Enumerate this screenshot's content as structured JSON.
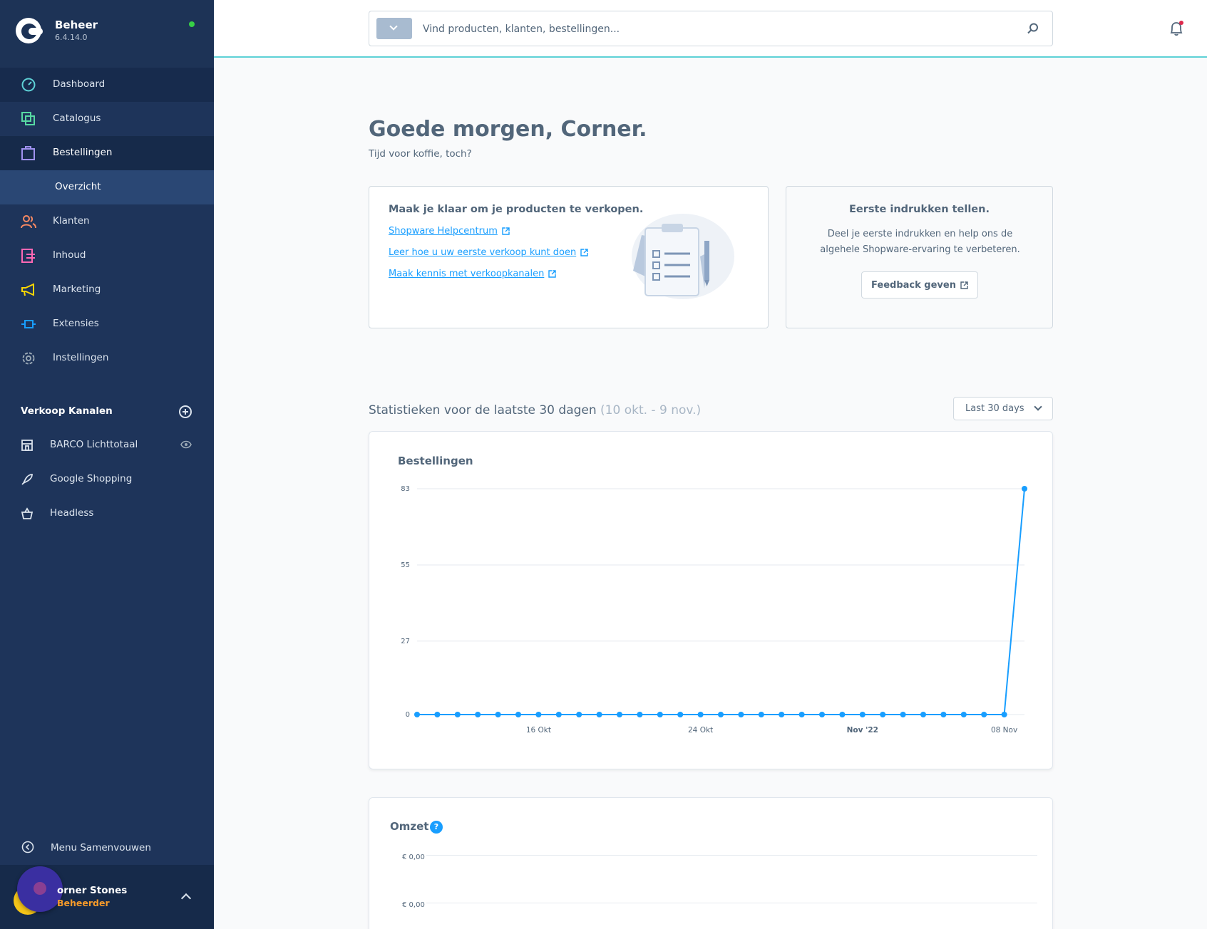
{
  "brand": {
    "title": "Beheer",
    "version": "6.4.14.0",
    "status_color": "#37d046"
  },
  "nav": {
    "items": [
      {
        "label": "Dashboard",
        "icon": "dashboard-icon",
        "color": "#5ed1d6"
      },
      {
        "label": "Catalogus",
        "icon": "catalog-icon",
        "color": "#57d9a3"
      },
      {
        "label": "Bestellingen",
        "icon": "orders-icon",
        "color": "#a092f0"
      },
      {
        "label": "Klanten",
        "icon": "customers-icon",
        "color": "#f88962"
      },
      {
        "label": "Inhoud",
        "icon": "content-icon",
        "color": "#ff68b4"
      },
      {
        "label": "Marketing",
        "icon": "marketing-icon",
        "color": "#ffd700"
      },
      {
        "label": "Extensies",
        "icon": "extensions-icon",
        "color": "#189eff"
      },
      {
        "label": "Instellingen",
        "icon": "settings-icon",
        "color": "#9aa8b5"
      }
    ],
    "sub_item": "Overzicht"
  },
  "sales_channels": {
    "heading": "Verkoop Kanalen",
    "items": [
      {
        "label": "BARCO Lichttotaal",
        "icon": "storefront-icon"
      },
      {
        "label": "Google Shopping",
        "icon": "rocket-icon"
      },
      {
        "label": "Headless",
        "icon": "basket-icon"
      }
    ]
  },
  "collapse_label": "Menu Samenvouwen",
  "user": {
    "name": "orner Stones",
    "role": "Beheerder"
  },
  "search": {
    "placeholder": "Vind producten, klanten, bestellingen..."
  },
  "greeting": {
    "title": "Goede morgen, Corner.",
    "subtitle": "Tijd voor koffie, toch?"
  },
  "getting_started": {
    "title": "Maak je klaar om je producten te verkopen.",
    "links": [
      "Shopware Helpcentrum",
      "Leer hoe u uw eerste verkoop kunt doen",
      "Maak kennis met verkoopkanalen"
    ]
  },
  "feedback": {
    "title": "Eerste indrukken tellen.",
    "text": "Deel je eerste indrukken en help ons de algehele Shopware-ervaring te verbeteren.",
    "button": "Feedback geven"
  },
  "stats": {
    "title": "Statistieken voor de laatste 30 dagen",
    "range": "(10 okt. - 9 nov.)",
    "period": "Last 30 days"
  },
  "chart_data": {
    "type": "line",
    "title": "Bestellingen",
    "x_tick_labels": [
      "16 Okt",
      "24 Okt",
      "Nov '22",
      "08 Nov"
    ],
    "x_tick_index": [
      6,
      14,
      22,
      29
    ],
    "y_ticks": [
      0,
      27,
      55,
      83
    ],
    "ylim": [
      0,
      83
    ],
    "grid": true,
    "series_color": "#189eff",
    "values": [
      0,
      0,
      0,
      0,
      0,
      0,
      0,
      0,
      0,
      0,
      0,
      0,
      0,
      0,
      0,
      0,
      0,
      0,
      0,
      0,
      0,
      0,
      0,
      0,
      0,
      0,
      0,
      0,
      0,
      0,
      83
    ]
  },
  "revenue": {
    "title": "Omzet",
    "help": "?",
    "ticks": [
      "€ 0,00",
      "€ 0,00"
    ]
  }
}
